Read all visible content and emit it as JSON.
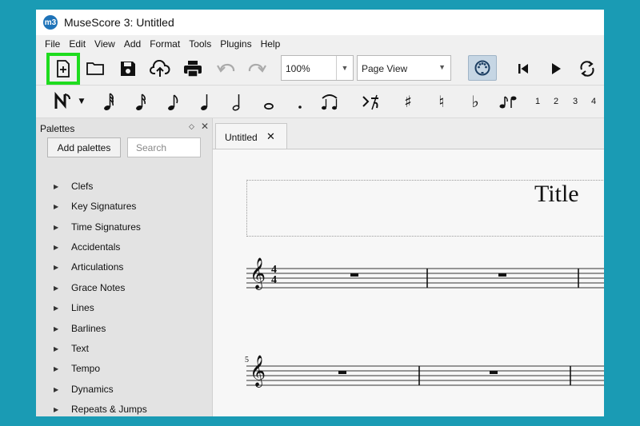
{
  "window": {
    "title": "MuseScore 3: Untitled",
    "logo_text": "m3"
  },
  "menu": [
    "File",
    "Edit",
    "View",
    "Add",
    "Format",
    "Tools",
    "Plugins",
    "Help"
  ],
  "toolbar": {
    "zoom_value": "100%",
    "view_mode": "Page View",
    "highlight_color": "#1fdc1f"
  },
  "note_toolbar": {
    "voices": [
      "1",
      "2",
      "3",
      "4"
    ]
  },
  "palettes": {
    "title": "Palettes",
    "add_button": "Add palettes",
    "search_placeholder": "Search",
    "items": [
      "Clefs",
      "Key Signatures",
      "Time Signatures",
      "Accidentals",
      "Articulations",
      "Grace Notes",
      "Lines",
      "Barlines",
      "Text",
      "Tempo",
      "Dynamics",
      "Repeats & Jumps"
    ]
  },
  "score": {
    "tab_label": "Untitled",
    "title": "Title",
    "measure_number": "5",
    "time_signature": {
      "top": "4",
      "bottom": "4"
    }
  }
}
